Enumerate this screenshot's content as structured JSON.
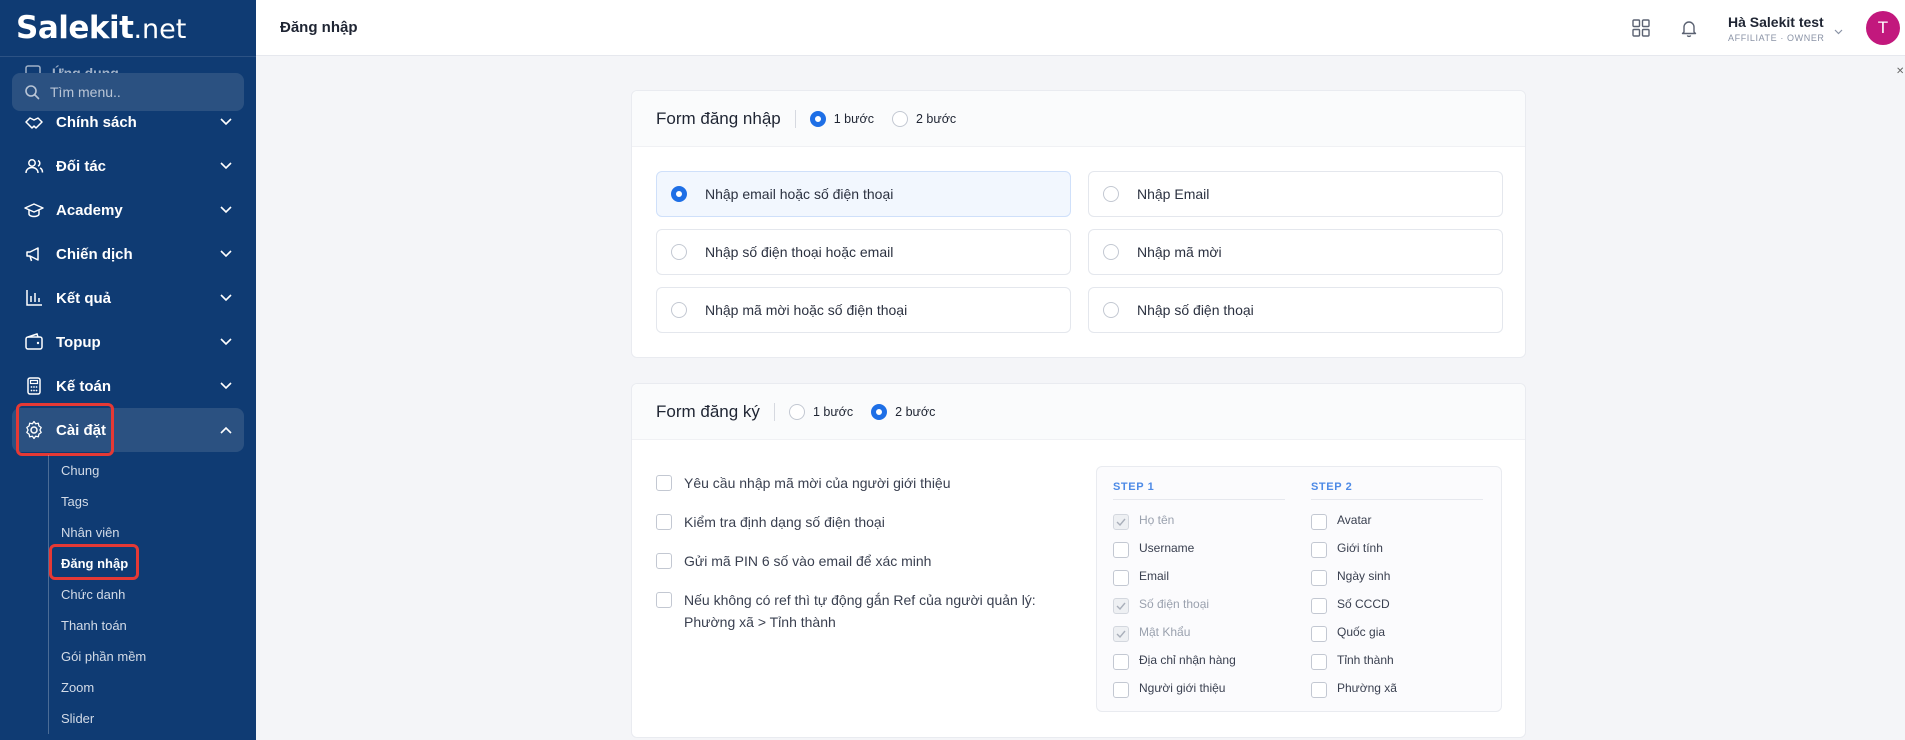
{
  "brand": {
    "name": "Salekit",
    "tld": ".net"
  },
  "sidebar": {
    "ghost_item": "Ứng dụng",
    "search_placeholder": "Tìm menu..",
    "items": [
      {
        "label": "Chính sách",
        "icon": "handshake-icon"
      },
      {
        "label": "Đối tác",
        "icon": "users-icon"
      },
      {
        "label": "Academy",
        "icon": "graduation-cap-icon"
      },
      {
        "label": "Chiến dịch",
        "icon": "megaphone-icon"
      },
      {
        "label": "Kết quả",
        "icon": "bar-chart-icon"
      },
      {
        "label": "Topup",
        "icon": "wallet-icon"
      },
      {
        "label": "Kế toán",
        "icon": "calculator-icon"
      },
      {
        "label": "Cài đặt",
        "icon": "gear-icon"
      }
    ],
    "subitems": [
      "Chung",
      "Tags",
      "Nhân viên",
      "Đăng nhập",
      "Chức danh",
      "Thanh toán",
      "Gói phần mềm",
      "Zoom",
      "Slider"
    ]
  },
  "topbar": {
    "title": "Đăng nhập",
    "user_name": "Hà Salekit test",
    "user_roles": "AFFILIATE · OWNER",
    "avatar_letter": "T"
  },
  "login_form": {
    "title": "Form đăng nhập",
    "step_options": [
      "1 bước",
      "2 bước"
    ],
    "selected_step": "1 bước",
    "options": [
      "Nhập email hoặc số điện thoại",
      "Nhập Email",
      "Nhập số điện thoại hoặc email",
      "Nhập mã mời",
      "Nhập mã mời hoặc số điện thoại",
      "Nhập số điện thoại"
    ],
    "selected_option": "Nhập email hoặc số điện thoại"
  },
  "register_form": {
    "title": "Form đăng ký",
    "step_options": [
      "1 bước",
      "2 bước"
    ],
    "selected_step": "2 bước",
    "checks": [
      "Yêu cầu nhập mã mời của người giới thiệu",
      "Kiểm tra định dạng số điện thoại",
      "Gửi mã PIN 6 số vào email để xác minh",
      "Nếu không có ref thì tự động gắn Ref của người quản lý: Phường xã > Tỉnh thành"
    ],
    "step1": {
      "heading": "STEP 1",
      "fields": [
        {
          "label": "Họ tên",
          "locked": true
        },
        {
          "label": "Username",
          "locked": false
        },
        {
          "label": "Email",
          "locked": false
        },
        {
          "label": "Số điện thoại",
          "locked": true
        },
        {
          "label": "Mật Khẩu",
          "locked": true
        },
        {
          "label": "Địa chỉ nhận hàng",
          "locked": false
        },
        {
          "label": "Người giới thiệu",
          "locked": false
        }
      ]
    },
    "step2": {
      "heading": "STEP 2",
      "fields": [
        "Avatar",
        "Giới tính",
        "Ngày sinh",
        "Số CCCD",
        "Quốc gia",
        "Tỉnh thành",
        "Phường xã"
      ]
    }
  },
  "colors": {
    "sidebar": "#0f3b73",
    "accent": "#1e6fe6",
    "highlight": "#e53935",
    "avatar": "#c2187d"
  }
}
